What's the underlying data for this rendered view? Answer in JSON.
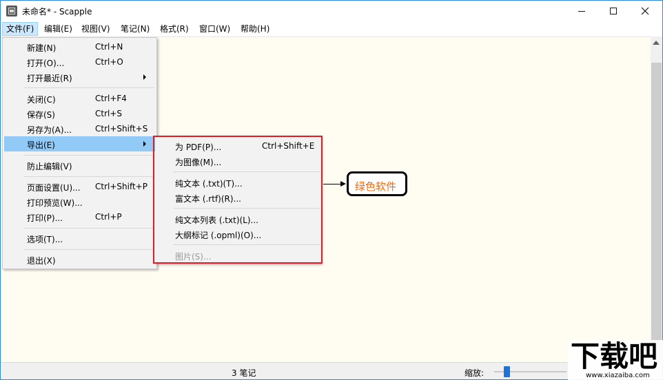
{
  "window": {
    "title": "未命名* - Scapple",
    "accent": "#2b8ad8"
  },
  "menubar": {
    "items": [
      "文件(F)",
      "编辑(E)",
      "视图(V)",
      "笔记(N)",
      "格式(R)",
      "窗口(W)",
      "帮助(H)"
    ],
    "active_index": 0
  },
  "file_menu": {
    "items": [
      {
        "label": "新建(N)",
        "shortcut": "Ctrl+N"
      },
      {
        "label": "打开(O)...",
        "shortcut": "Ctrl+O"
      },
      {
        "label": "打开最近(R)",
        "shortcut": "",
        "submenu": true
      },
      {
        "label": "关闭(C)",
        "shortcut": "Ctrl+F4"
      },
      {
        "label": "保存(S)",
        "shortcut": "Ctrl+S"
      },
      {
        "label": "另存为(A)...",
        "shortcut": "Ctrl+Shift+S"
      },
      {
        "label": "导出(E)",
        "shortcut": "",
        "submenu": true,
        "highlighted": true
      },
      {
        "label": "防止编辑(V)",
        "shortcut": ""
      },
      {
        "label": "页面设置(U)...",
        "shortcut": "Ctrl+Shift+P"
      },
      {
        "label": "打印预览(W)...",
        "shortcut": ""
      },
      {
        "label": "打印(P)...",
        "shortcut": "Ctrl+P"
      },
      {
        "label": "选项(T)...",
        "shortcut": ""
      },
      {
        "label": "退出(X)",
        "shortcut": ""
      }
    ]
  },
  "export_submenu": {
    "items": [
      {
        "label": "为 PDF(P)...",
        "shortcut": "Ctrl+Shift+E"
      },
      {
        "label": "为图像(M)...",
        "shortcut": ""
      },
      {
        "label": "纯文本 (.txt)(T)...",
        "shortcut": ""
      },
      {
        "label": "富文本 (.rtf)(R)...",
        "shortcut": ""
      },
      {
        "label": "纯文本列表 (.txt)(L)...",
        "shortcut": ""
      },
      {
        "label": "大纲标记 (.opml)(O)...",
        "shortcut": ""
      },
      {
        "label": "图片(S)...",
        "shortcut": "",
        "disabled": true
      }
    ],
    "highlight_color": "#e01b22"
  },
  "callout": {
    "text": "绿色软件",
    "text_color": "#ff6600"
  },
  "statusbar": {
    "note_count": "3 笔记",
    "zoom_label": "缩放:"
  },
  "watermark": {
    "big": "下载吧",
    "small": "www.xiazaiba.com"
  }
}
